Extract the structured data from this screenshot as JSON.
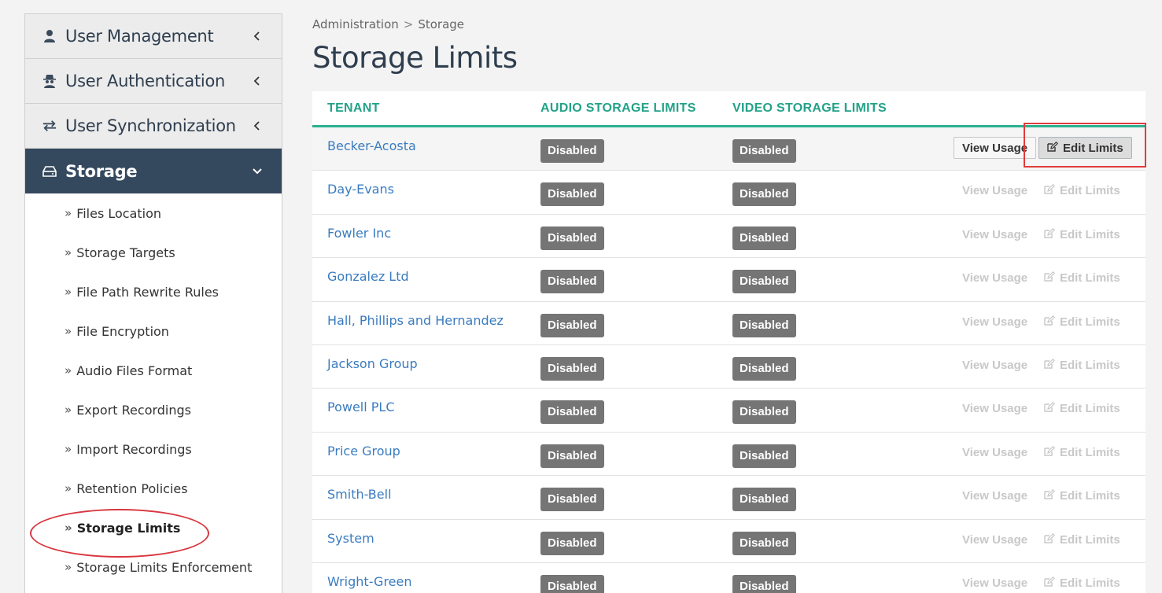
{
  "sidebar": {
    "top_items": [
      {
        "label": "User Management",
        "icon": "user-icon"
      },
      {
        "label": "User Authentication",
        "icon": "spy-icon"
      },
      {
        "label": "User Synchronization",
        "icon": "exchange-icon"
      },
      {
        "label": "Storage",
        "icon": "hdd-icon"
      }
    ],
    "sub_items": [
      "Files Location",
      "Storage Targets",
      "File Path Rewrite Rules",
      "File Encryption",
      "Audio Files Format",
      "Export Recordings",
      "Import Recordings",
      "Retention Policies",
      "Storage Limits",
      "Storage Limits Enforcement"
    ],
    "bullet": "»"
  },
  "breadcrumb": {
    "parent": "Administration",
    "separator": ">",
    "current": "Storage"
  },
  "page_title": "Storage Limits",
  "table": {
    "headers": {
      "tenant": "TENANT",
      "audio": "AUDIO STORAGE LIMITS",
      "video": "VIDEO STORAGE LIMITS"
    },
    "view_label": "View Usage",
    "edit_label": "Edit Limits",
    "rows": [
      {
        "tenant": "Becker-Acosta",
        "audio": "Disabled",
        "video": "Disabled"
      },
      {
        "tenant": "Day-Evans",
        "audio": "Disabled",
        "video": "Disabled"
      },
      {
        "tenant": "Fowler Inc",
        "audio": "Disabled",
        "video": "Disabled"
      },
      {
        "tenant": "Gonzalez Ltd",
        "audio": "Disabled",
        "video": "Disabled"
      },
      {
        "tenant": "Hall, Phillips and Hernandez",
        "audio": "Disabled",
        "video": "Disabled"
      },
      {
        "tenant": "Jackson Group",
        "audio": "Disabled",
        "video": "Disabled"
      },
      {
        "tenant": "Powell PLC",
        "audio": "Disabled",
        "video": "Disabled"
      },
      {
        "tenant": "Price Group",
        "audio": "Disabled",
        "video": "Disabled"
      },
      {
        "tenant": "Smith-Bell",
        "audio": "Disabled",
        "video": "Disabled"
      },
      {
        "tenant": "System",
        "audio": "Disabled",
        "video": "Disabled"
      },
      {
        "tenant": "Wright-Green",
        "audio": "Disabled",
        "video": "Disabled"
      }
    ]
  },
  "colors": {
    "accent": "#2bb191",
    "sidebar_active": "#34495e",
    "link": "#3a7cc0",
    "badge": "#757575",
    "annotation": "#e03b3b"
  }
}
